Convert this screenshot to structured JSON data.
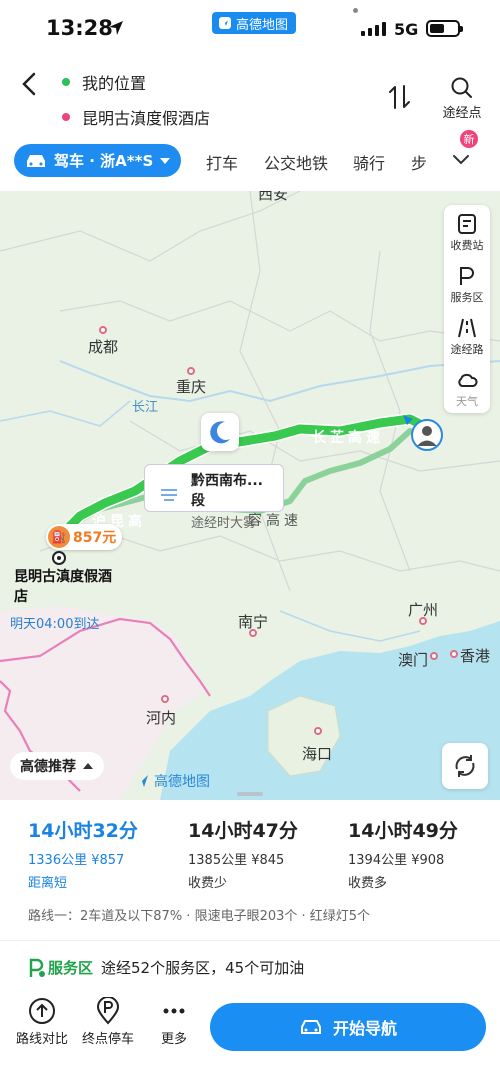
{
  "status_bar": {
    "time": "13:28",
    "app_label": "高德地图",
    "network": "5G"
  },
  "header": {
    "origin": "我的位置",
    "destination": "昆明古滇度假酒店",
    "via_label": "途经点",
    "origin_color": "#2bbf5a",
    "destination_color": "#f0437b"
  },
  "modes": {
    "active": "驾车 · 浙A**S",
    "tabs": [
      "打车",
      "公交地铁",
      "骑行",
      "步"
    ],
    "new_badge": "新"
  },
  "map": {
    "cities": {
      "xian": "西安",
      "chengdu": "成都",
      "chongqing": "重庆",
      "nanning": "南宁",
      "guangzhou": "广州",
      "macau": "澳门",
      "hongkong": "香港",
      "hanoi": "河内",
      "haikou": "海口"
    },
    "river": "长江",
    "highways": {
      "changzhi": "长芷高速",
      "hukun": "沪昆高",
      "rong": "容高速"
    },
    "weather_bubble": {
      "title": "黔西南布...段",
      "subtitle": "途经时大雾"
    },
    "fuel_price": "857元",
    "destination_label": "昆明古滇度假酒店",
    "arrival": "明天04:00到达",
    "tools": [
      "收费站",
      "服务区",
      "途经路",
      "天气"
    ],
    "recommend": "高德推荐",
    "logo": "高德地图",
    "route_color": "#39c94f"
  },
  "routes": [
    {
      "duration": "14小时32分",
      "distance": "1336公里",
      "price": "¥857",
      "tag": "距离短",
      "selected": true
    },
    {
      "duration": "14小时47分",
      "distance": "1385公里",
      "price": "¥845",
      "tag": "收费少",
      "selected": false
    },
    {
      "duration": "14小时49分",
      "distance": "1394公里",
      "price": "¥908",
      "tag": "收费多",
      "selected": false
    }
  ],
  "route_info": "路线一：2车道及以下87% · 限速电子眼203个 · 红绿灯5个",
  "service": {
    "badge": "服务区",
    "text": "途经52个服务区，45个可加油"
  },
  "actions": {
    "compare": "路线对比",
    "parking": "终点停车",
    "more": "更多",
    "start": "开始导航"
  }
}
